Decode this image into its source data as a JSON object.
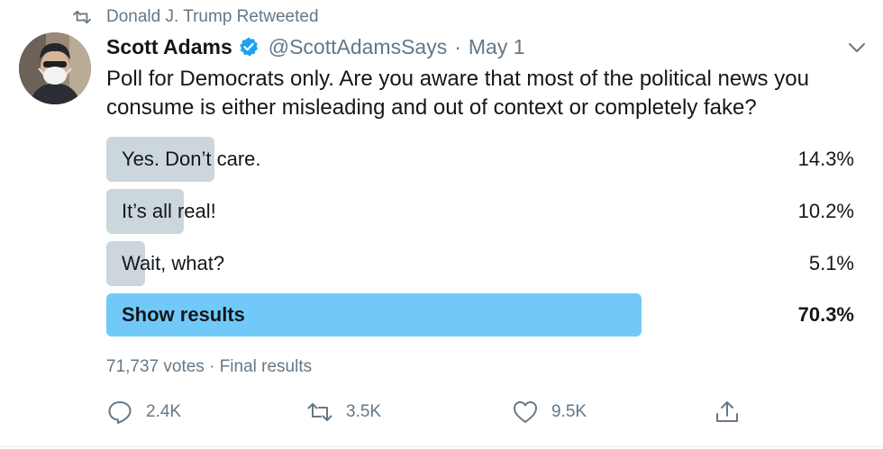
{
  "retweet_context": {
    "text": "Donald J. Trump Retweeted",
    "icon": "retweet-icon"
  },
  "author": {
    "name": "Scott Adams",
    "verified": true,
    "handle": "@ScottAdamsSays",
    "separator": "·",
    "date": "May 1"
  },
  "tweet": {
    "text": "Poll for Democrats only. Are you aware that most of the political news you consume is either misleading and out of context or completely fake?"
  },
  "poll": {
    "options": [
      {
        "label": "Yes. Don’t care.",
        "percent_label": "14.3%",
        "percent": 14.3
      },
      {
        "label": "It’s all real!",
        "percent_label": "10.2%",
        "percent": 10.2
      },
      {
        "label": "Wait, what?",
        "percent_label": "5.1%",
        "percent": 5.1
      },
      {
        "label": "Show results",
        "percent_label": "70.3%",
        "percent": 70.3
      }
    ],
    "votes_text": "71,737 votes",
    "separator": "·",
    "status": "Final results"
  },
  "actions": {
    "reply": {
      "icon": "reply-icon",
      "count": "2.4K"
    },
    "retweet": {
      "icon": "retweet-icon",
      "count": "3.5K"
    },
    "like": {
      "icon": "heart-icon",
      "count": "9.5K"
    },
    "share": {
      "icon": "share-icon"
    }
  },
  "colors": {
    "muted": "#657786",
    "verified": "#1da1f2",
    "poll_bar": "#ccd6dd",
    "poll_winner": "#71c9f8"
  }
}
